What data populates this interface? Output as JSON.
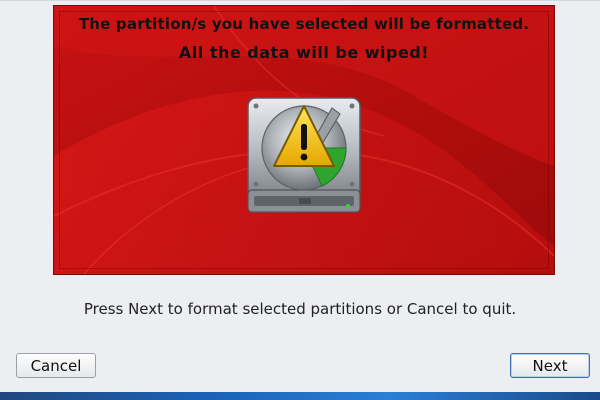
{
  "banner": {
    "warning_line_1": "The partition/s you have selected will be formatted.",
    "warning_line_2": "All the data will be wiped!",
    "icon": "hard-drive-warning-icon",
    "background_color": "#b40e0e"
  },
  "instruction": "Press Next to format selected partitions or Cancel to quit.",
  "buttons": {
    "cancel_label": "Cancel",
    "next_label": "Next"
  },
  "colors": {
    "dialog_background": "#eceef1",
    "warning_yellow": "#f5c400",
    "progress_green": "#2fa52f"
  }
}
